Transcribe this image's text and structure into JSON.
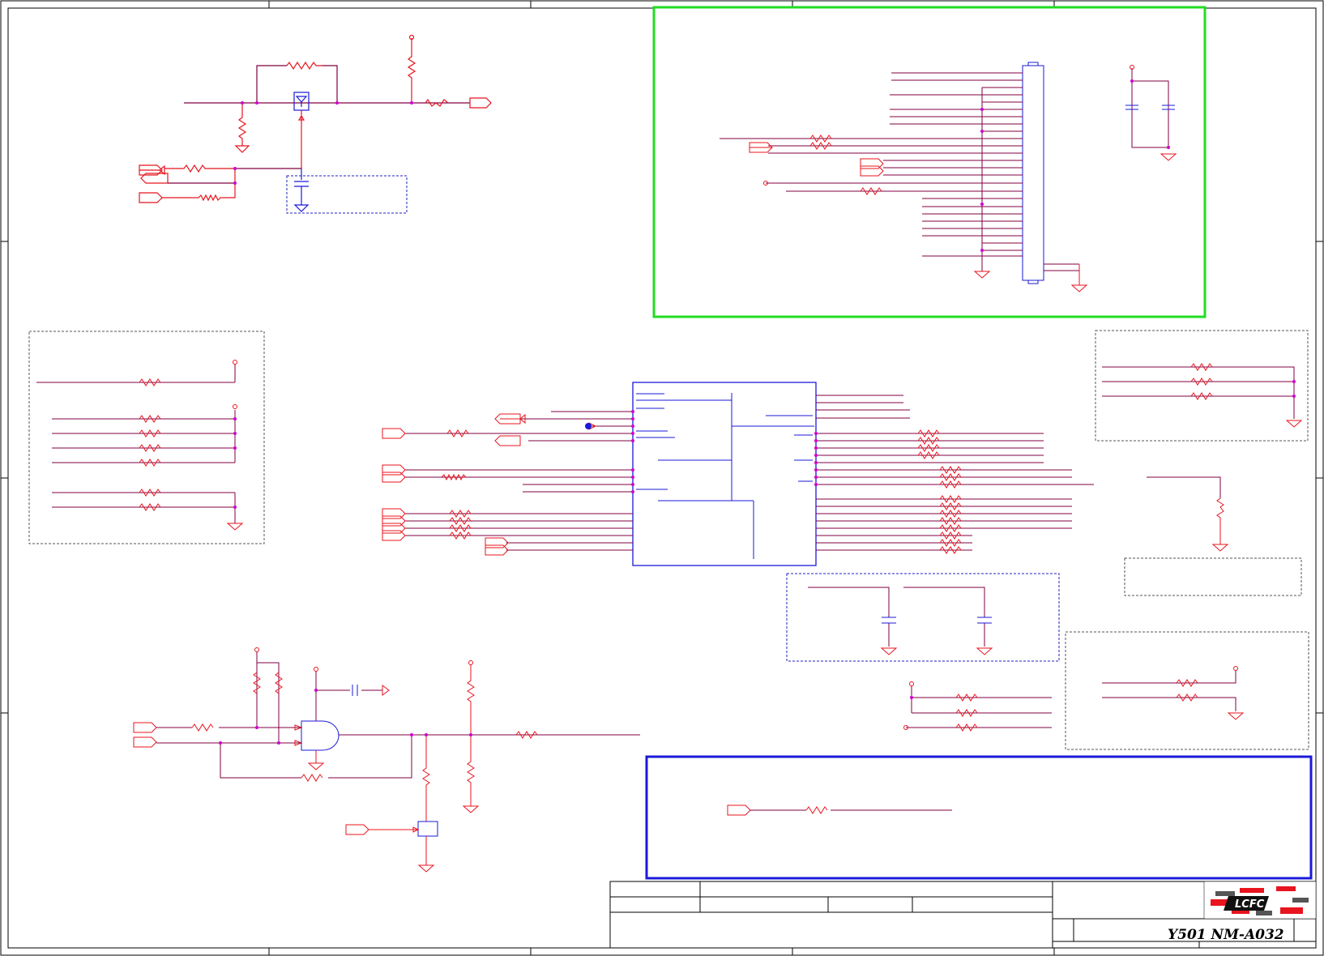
{
  "title_block": {
    "model": "Y501  NM-A032",
    "logo": "LCFC"
  },
  "colors": {
    "wire": "#800040",
    "component": "#e8141e",
    "ic_outline": "#1a1ad8",
    "highlight_green": "#22dd22",
    "highlight_blue": "#1a1ad8",
    "frame": "#000000",
    "junction": "#d000d0"
  }
}
